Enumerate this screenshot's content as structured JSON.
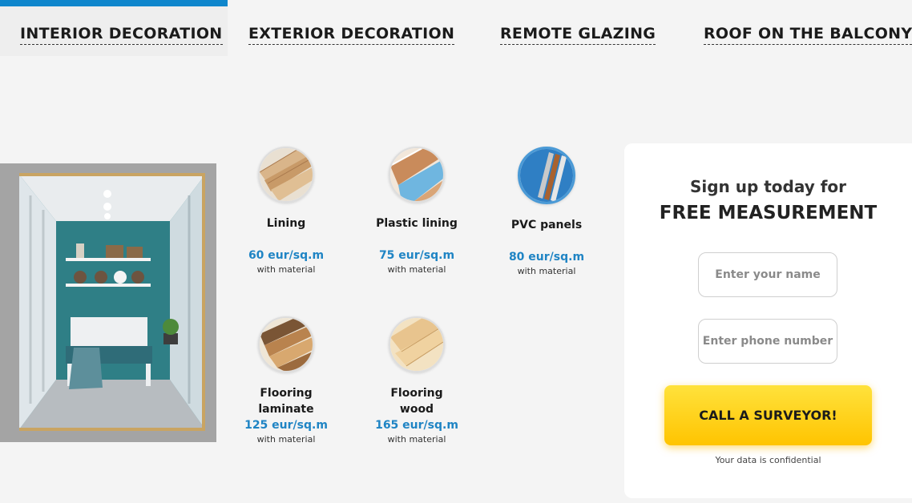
{
  "tabs": [
    {
      "label": "INTERIOR DECORATION",
      "active": true
    },
    {
      "label": "EXTERIOR DECORATION",
      "active": false
    },
    {
      "label": "REMOTE GLAZING",
      "active": false
    },
    {
      "label": "ROOF ON THE BALCONY",
      "active": false
    }
  ],
  "accent_color": "#0f86cc",
  "price_color": "#1f84c4",
  "products": [
    {
      "name": "Lining",
      "price": "60 eur/sq.m",
      "note": "with material",
      "icon": "wood-lining-icon"
    },
    {
      "name": "Plastic lining",
      "price": "75 eur/sq.m",
      "note": "with material",
      "icon": "plastic-lining-icon"
    },
    {
      "name": "PVC panels",
      "price": "80 eur/sq.m",
      "note": "with material",
      "icon": "pvc-panels-icon"
    },
    {
      "name": "Flooring laminate",
      "name_line1": "Flooring",
      "name_line2": "laminate",
      "price": "125 eur/sq.m",
      "note": "with material",
      "icon": "laminate-icon"
    },
    {
      "name": "Flooring wood",
      "name_line1": "Flooring",
      "name_line2": "wood",
      "price": "165 eur/sq.m",
      "note": "with material",
      "icon": "wood-flooring-icon"
    }
  ],
  "form": {
    "subtitle": "Sign up today for",
    "title": "FREE MEASUREMENT",
    "name_placeholder": "Enter your name",
    "phone_placeholder": "Enter phone number",
    "button_label": "CALL A SURVEYOR!",
    "button_color": "#ffd21a",
    "confidential": "Your data is confidential"
  }
}
